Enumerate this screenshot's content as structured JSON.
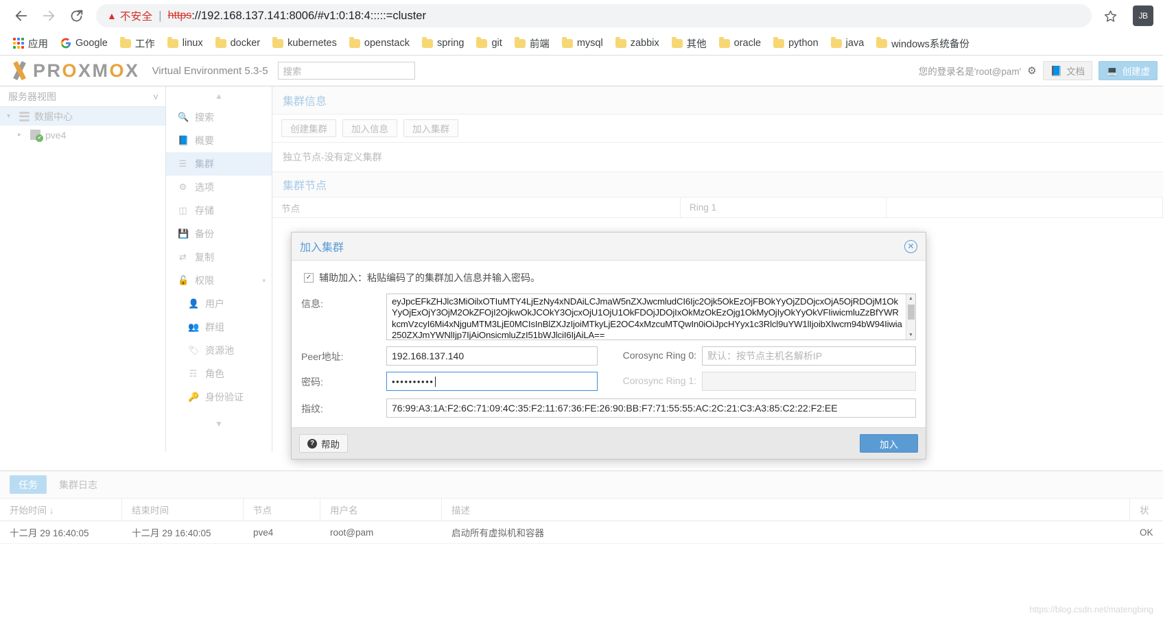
{
  "browser": {
    "back_icon": "back-arrow-icon",
    "forward_icon": "forward-arrow-icon",
    "reload_icon": "reload-icon",
    "security_warning": "不安全",
    "url_scheme": "https",
    "url_rest": "://192.168.137.141:8006/#v1:0:18:4:::::=cluster",
    "url_host": "192.168.137.141:8006",
    "star_icon": "bookmark-star-icon",
    "profile_initials": "JB",
    "bookmarks": [
      {
        "label": "应用",
        "icon": "apps-grid-icon"
      },
      {
        "label": "Google",
        "icon": "google-icon"
      },
      {
        "label": "工作",
        "icon": "folder-icon"
      },
      {
        "label": "linux",
        "icon": "folder-icon"
      },
      {
        "label": "docker",
        "icon": "folder-icon"
      },
      {
        "label": "kubernetes",
        "icon": "folder-icon"
      },
      {
        "label": "openstack",
        "icon": "folder-icon"
      },
      {
        "label": "spring",
        "icon": "folder-icon"
      },
      {
        "label": "git",
        "icon": "folder-icon"
      },
      {
        "label": "前端",
        "icon": "folder-icon"
      },
      {
        "label": "mysql",
        "icon": "folder-icon"
      },
      {
        "label": "zabbix",
        "icon": "folder-icon"
      },
      {
        "label": "其他",
        "icon": "folder-icon"
      },
      {
        "label": "oracle",
        "icon": "folder-icon"
      },
      {
        "label": "python",
        "icon": "folder-icon"
      },
      {
        "label": "java",
        "icon": "folder-icon"
      },
      {
        "label": "windows系统备份",
        "icon": "folder-icon"
      }
    ]
  },
  "pve_header": {
    "brand_pre": "PR",
    "brand_o": "O",
    "brand_post": "XM",
    "brand_o2": "O",
    "brand_tail": "X",
    "brand_full": "PROXMOX",
    "product": "Virtual Environment 5.3-5",
    "search_placeholder": "搜索",
    "user_text": "您的登录名是'root@pam'",
    "gear_icon": "gear-icon",
    "docs_label": "文档",
    "create_vm_label": "创建虚"
  },
  "tree": {
    "view_label": "服务器视图",
    "chevron_icon": "chevron-down-icon",
    "items": [
      {
        "label": "数据中心",
        "icon": "datacenter-icon",
        "selected": true
      },
      {
        "label": "pve4",
        "icon": "node-icon",
        "selected": false
      }
    ]
  },
  "menu": {
    "items": [
      {
        "label": "搜索",
        "icon": "search-icon",
        "sub": false,
        "selected": false
      },
      {
        "label": "概要",
        "icon": "summary-book-icon",
        "sub": false,
        "selected": false
      },
      {
        "label": "集群",
        "icon": "cluster-icon",
        "sub": false,
        "selected": true
      },
      {
        "label": "选项",
        "icon": "gear-icon",
        "sub": false,
        "selected": false
      },
      {
        "label": "存储",
        "icon": "storage-icon",
        "sub": false,
        "selected": false
      },
      {
        "label": "备份",
        "icon": "backup-save-icon",
        "sub": false,
        "selected": false
      },
      {
        "label": "复制",
        "icon": "replication-icon",
        "sub": false,
        "selected": false
      },
      {
        "label": "权限",
        "icon": "lock-open-icon",
        "sub": false,
        "selected": false,
        "caret": true
      },
      {
        "label": "用户",
        "icon": "user-icon",
        "sub": true,
        "selected": false
      },
      {
        "label": "群组",
        "icon": "group-icon",
        "sub": true,
        "selected": false
      },
      {
        "label": "资源池",
        "icon": "tag-pool-icon",
        "sub": true,
        "selected": false
      },
      {
        "label": "角色",
        "icon": "role-person-icon",
        "sub": true,
        "selected": false
      },
      {
        "label": "身份验证",
        "icon": "key-auth-icon",
        "sub": true,
        "selected": false
      }
    ]
  },
  "main": {
    "cluster_info_title": "集群信息",
    "buttons": [
      {
        "label": "创建集群"
      },
      {
        "label": "加入信息"
      },
      {
        "label": "加入集群"
      }
    ],
    "standalone_note": "独立节点-没有定义集群",
    "cluster_nodes_title": "集群节点",
    "grid_headers": [
      "节点",
      "Ring 1"
    ]
  },
  "dialog": {
    "title": "加入集群",
    "close_icon": "close-circle-icon",
    "assist_checkbox_checked": true,
    "assist_check_glyph": "✓",
    "assist_label": "辅助加入：粘贴编码了的集群加入信息并输入密码。",
    "info_label": "信息:",
    "info_value": "eyJpcEFkZHJlc3MiOilxOTIuMTY4LjEzNy4xNDAiLCJmaW5nZXJwcmludCI6Ijc2Ojk5OkEzOjFBOkYyOjZDOjcxOjA5OjRDOjM1OkYyOjExOjY3OjM2OkZFOjI2OjkwOkJCOkY3OjcxOjU1OjU1OkFDOjJDOjIxOkMzOkEzOjg1OkMyOjIyOkYyOkVFIiwicmluZzBfYWRkcmVzcyI6Mi4xNjguMTM3LjE0MCIsInBlZXJzIjoiMTkyLjE2OC4xMzcuMTQwIn0iOiJpcHYyx1c3Rlcl9uYW1lIjoibXlwcm94bW94Iiwia250ZXJmYWNlIjp7IjAiOnsicmluZzI51bWJlciI6IjAiLA==",
    "peer_label": "Peer地址:",
    "peer_value": "192.168.137.140",
    "password_label": "密码:",
    "password_value": "••••••••••",
    "ring0_label": "Corosync Ring 0:",
    "ring0_placeholder": "默认：按节点主机名解析IP",
    "ring1_label": "Corosync Ring 1:",
    "ring1_value": "",
    "fingerprint_label": "指纹:",
    "fingerprint_value": "76:99:A3:1A:F2:6C:71:09:4C:35:F2:11:67:36:FE:26:90:BB:F7:71:55:55:AC:2C:21:C3:A3:85:C2:22:F2:EE",
    "help_label": "帮助",
    "help_icon": "question-circle-icon",
    "submit_label": "加入",
    "scroll_up_icon": "chevron-up-icon",
    "scroll_down_icon": "chevron-down-icon"
  },
  "tasks": {
    "tabs": [
      {
        "label": "任务",
        "active": true
      },
      {
        "label": "集群日志",
        "active": false
      }
    ],
    "headers": [
      "开始时间 ↓",
      "结束时间",
      "节点",
      "用户名",
      "描述",
      "状"
    ],
    "rows": [
      {
        "start": "十二月 29 16:40:05",
        "end": "十二月 29 16:40:05",
        "node": "pve4",
        "user": "root@pam",
        "description": "启动所有虚拟机和容器",
        "status": "OK"
      }
    ]
  },
  "watermark": "https://blog.csdn.net/matengbing"
}
